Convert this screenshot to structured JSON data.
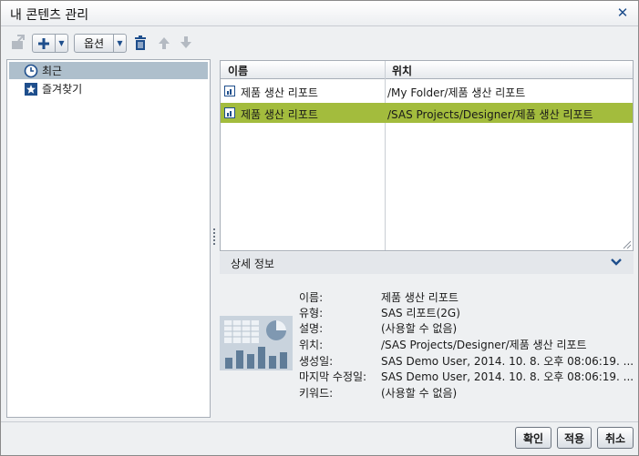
{
  "dialog": {
    "title": "내 콘텐츠 관리",
    "close_icon": "close-icon"
  },
  "toolbar": {
    "import_icon": "import-icon",
    "add_icon": "plus-icon",
    "options_label": "옵션",
    "delete_icon": "trash-icon",
    "move_up_icon": "arrow-up-icon",
    "move_down_icon": "arrow-down-icon"
  },
  "sidebar": {
    "items": [
      {
        "label": "최근",
        "icon": "history-icon",
        "selected": true
      },
      {
        "label": "즐겨찾기",
        "icon": "star-icon",
        "selected": false
      }
    ]
  },
  "grid": {
    "columns": [
      "이름",
      "위치"
    ],
    "rows": [
      {
        "name": "제품 생산 리포트",
        "location": "/My Folder/제품 생산 리포트",
        "selected": false
      },
      {
        "name": "제품 생산 리포트",
        "location": "/SAS Projects/Designer/제품 생산 리포트",
        "selected": true
      }
    ]
  },
  "details": {
    "title": "상세 정보",
    "properties": [
      {
        "key": "이름:",
        "value": "제품 생산 리포트"
      },
      {
        "key": "유형:",
        "value": "SAS 리포트(2G)"
      },
      {
        "key": "설명:",
        "value": "(사용할 수 없음)"
      },
      {
        "key": "위치:",
        "value": "/SAS Projects/Designer/제품 생산 리포트"
      },
      {
        "key": "생성일:",
        "value": "SAS Demo User, 2014. 10. 8. 오후 08:06:19. ..."
      },
      {
        "key": "마지막 수정일:",
        "value": "SAS Demo User, 2014. 10. 8. 오후 08:06:19. ..."
      },
      {
        "key": "키워드:",
        "value": "(사용할 수 없음)"
      }
    ]
  },
  "footer": {
    "ok_label": "확인",
    "apply_label": "적용",
    "cancel_label": "취소"
  },
  "colors": {
    "selection_green": "#a3bc3d",
    "sidebar_selection": "#aebfcc",
    "accent_blue": "#1e4e8c"
  }
}
